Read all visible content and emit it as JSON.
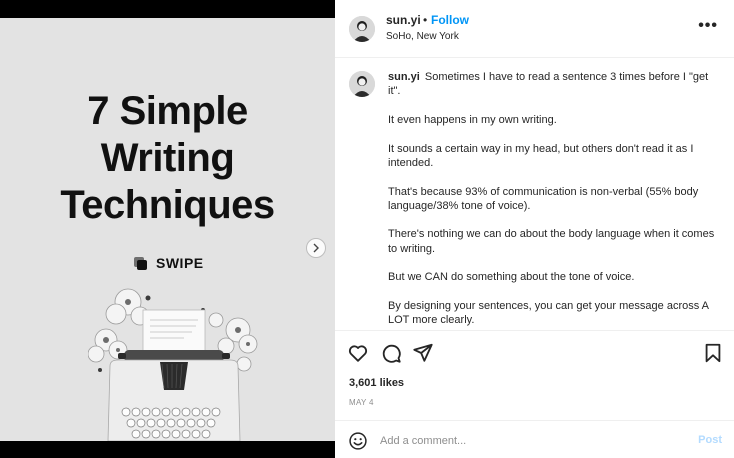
{
  "post": {
    "slide": {
      "title_lines": [
        "7 Simple",
        "Writing",
        "Techniques"
      ],
      "swipe_label": "SWIPE",
      "next_icon": "chevron-right-icon"
    },
    "author": {
      "username": "sun.yi",
      "separator": "•",
      "follow_label": "Follow",
      "location": "SoHo, New York"
    },
    "more_label": "•••",
    "caption": {
      "username": "sun.yi",
      "paragraphs": [
        "Sometimes I have to read a sentence 3 times before I \"get it\".",
        "It even happens in my own writing.",
        "It sounds a certain way in my head, but others don't read it as I intended.",
        "That's because 93% of communication is non-verbal (55% body language/38% tone of voice).",
        "There's nothing we can do about the body language when it comes to writing.",
        "But we CAN do something about the tone of voice.",
        "By designing your sentences, you can get your message across A LOT more clearly."
      ]
    },
    "actions": {
      "like_icon": "heart-icon",
      "comment_icon": "comment-icon",
      "share_icon": "send-icon",
      "save_icon": "bookmark-icon"
    },
    "likes": "3,601 likes",
    "date": "MAY 4",
    "comment": {
      "placeholder": "Add a comment...",
      "post_label": "Post",
      "emoji_icon": "emoji-icon"
    }
  },
  "colors": {
    "link_blue": "#0095f6",
    "post_disabled": "#b3dbff",
    "muted": "#8e8e8e",
    "text": "#262626"
  }
}
